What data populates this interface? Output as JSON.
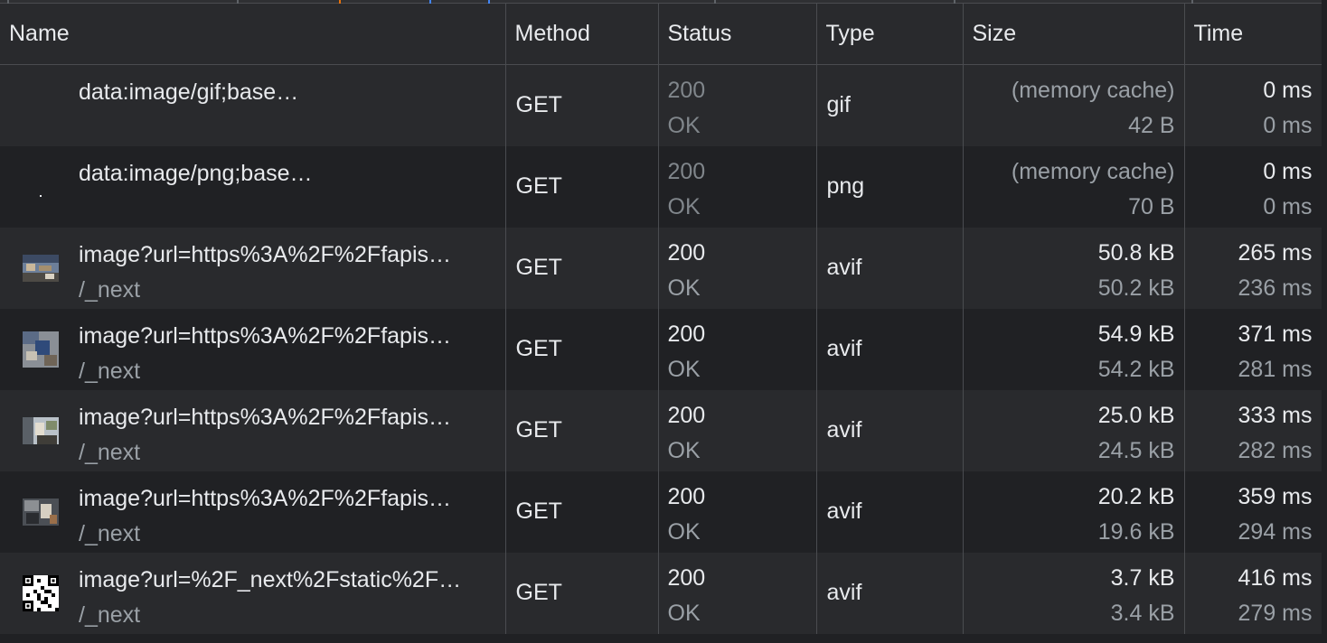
{
  "columns": {
    "name": "Name",
    "method": "Method",
    "status": "Status",
    "type": "Type",
    "size": "Size",
    "time": "Time"
  },
  "rows": [
    {
      "name": "data:image/gif;base…",
      "initiator": "",
      "method": "GET",
      "status_code": "200",
      "status_text": "OK",
      "type": "gif",
      "size": "(memory cache)",
      "resource_size": "42 B",
      "time": "0 ms",
      "latency": "0 ms",
      "thumb": "none-icon"
    },
    {
      "name": "data:image/png;base…",
      "initiator": "",
      "method": "GET",
      "status_code": "200",
      "status_text": "OK",
      "type": "png",
      "size": "(memory cache)",
      "resource_size": "70 B",
      "time": "0 ms",
      "latency": "0 ms",
      "thumb": "dot-icon"
    },
    {
      "name": "image?url=https%3A%2F%2Ffapis…",
      "initiator": "/_next",
      "method": "GET",
      "status_code": "200",
      "status_text": "OK",
      "type": "avif",
      "size": "50.8 kB",
      "resource_size": "50.2 kB",
      "time": "265 ms",
      "latency": "236 ms",
      "thumb": "image-thumbnail-icon"
    },
    {
      "name": "image?url=https%3A%2F%2Ffapis…",
      "initiator": "/_next",
      "method": "GET",
      "status_code": "200",
      "status_text": "OK",
      "type": "avif",
      "size": "54.9 kB",
      "resource_size": "54.2 kB",
      "time": "371 ms",
      "latency": "281 ms",
      "thumb": "image-thumbnail-icon"
    },
    {
      "name": "image?url=https%3A%2F%2Ffapis…",
      "initiator": "/_next",
      "method": "GET",
      "status_code": "200",
      "status_text": "OK",
      "type": "avif",
      "size": "25.0 kB",
      "resource_size": "24.5 kB",
      "time": "333 ms",
      "latency": "282 ms",
      "thumb": "image-thumbnail-icon"
    },
    {
      "name": "image?url=https%3A%2F%2Ffapis…",
      "initiator": "/_next",
      "method": "GET",
      "status_code": "200",
      "status_text": "OK",
      "type": "avif",
      "size": "20.2 kB",
      "resource_size": "19.6 kB",
      "time": "359 ms",
      "latency": "294 ms",
      "thumb": "image-thumbnail-icon"
    },
    {
      "name": "image?url=%2F_next%2Fstatic%2F…",
      "initiator": "/_next",
      "method": "GET",
      "status_code": "200",
      "status_text": "OK",
      "type": "avif",
      "size": "3.7 kB",
      "resource_size": "3.4 kB",
      "time": "416 ms",
      "latency": "279 ms",
      "thumb": "qr-code-icon"
    }
  ]
}
